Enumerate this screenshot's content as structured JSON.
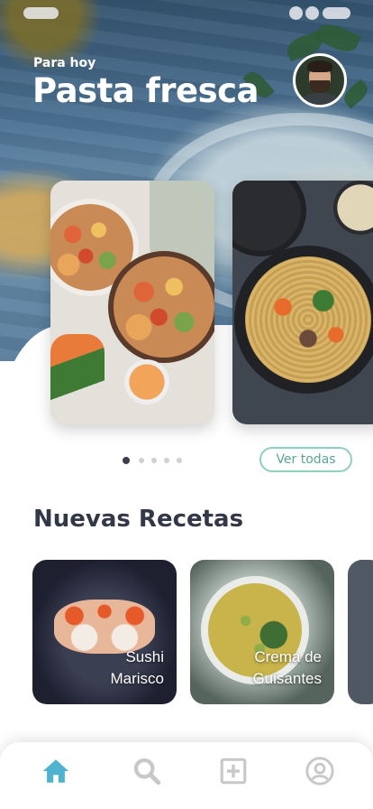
{
  "header": {
    "kicker": "Para hoy",
    "title": "Pasta fresca"
  },
  "carousel": {
    "cards": [
      {
        "name": "salad-bowls"
      },
      {
        "name": "noodle-bowl"
      }
    ],
    "page_count": 5,
    "active_page": 1,
    "view_all_label": "Ver todas"
  },
  "new_recipes": {
    "title": "Nuevas Recetas",
    "items": [
      {
        "line1": "Sushi",
        "line2": "Marisco"
      },
      {
        "line1": "Crema de",
        "line2": "Guisantes"
      }
    ]
  },
  "bottom_nav": {
    "items": [
      {
        "icon": "home-icon",
        "active": true
      },
      {
        "icon": "search-icon",
        "active": false
      },
      {
        "icon": "add-icon",
        "active": false
      },
      {
        "icon": "profile-icon",
        "active": false
      }
    ]
  },
  "colors": {
    "accent": "#4fb3cf",
    "inactive_icon": "#c7c7cc",
    "outline_button": "#8fd0c4",
    "heading": "#333848"
  }
}
